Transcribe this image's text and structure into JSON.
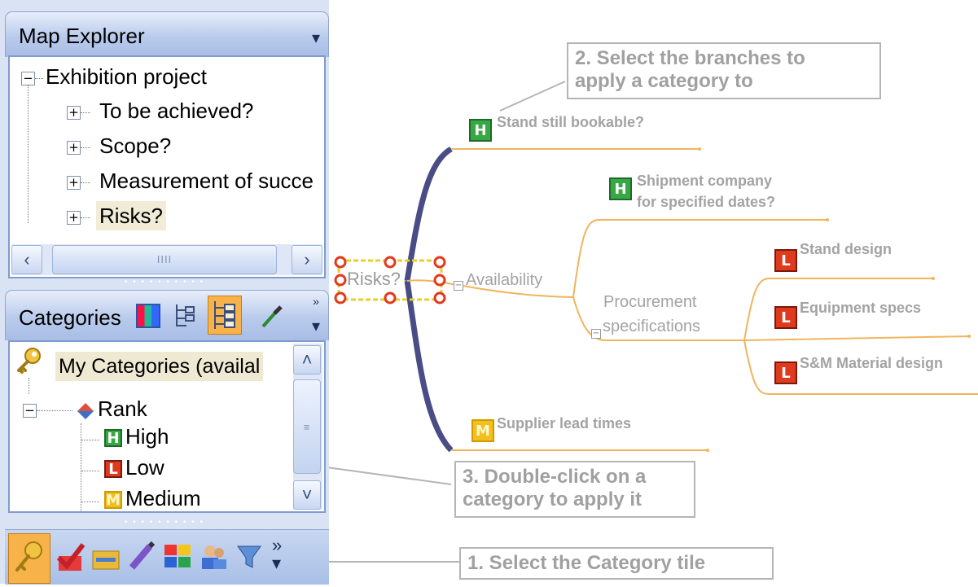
{
  "map_explorer": {
    "title": "Map Explorer",
    "root": "Exhibition project",
    "items": [
      "To be achieved?",
      "Scope?",
      "Measurement of succe",
      "Risks?"
    ],
    "scroll_grip": "IIII"
  },
  "categories_pane": {
    "title": "Categories",
    "group": "My Categories (availal",
    "rank": "Rank",
    "items": [
      {
        "tag": "H",
        "label": "High"
      },
      {
        "tag": "L",
        "label": "Low"
      },
      {
        "tag": "M",
        "label": "Medium"
      }
    ]
  },
  "map": {
    "central": "Risks?",
    "topics": {
      "stand": "Stand still bookable?",
      "availability": "Availability",
      "shipment_line1": "Shipment company",
      "shipment_line2": "for specified dates?",
      "procurement_line1": "Procurement",
      "procurement_line2": "specifications",
      "stand_design": "Stand design",
      "equipment": "Equipment specs",
      "sm_material": "S&M Material design",
      "supplier": "Supplier lead times"
    },
    "tags": {
      "stand": "H",
      "shipment": "H",
      "stand_design": "L",
      "equipment": "L",
      "sm_material": "L",
      "supplier": "M"
    }
  },
  "callouts": {
    "step2_line1": "2. Select the branches to",
    "step2_line2": "apply a category to",
    "step3_line1": "3. Double-click on a",
    "step3_line2": "category to apply it",
    "step1": "1. Select the Category tile"
  },
  "colors": {
    "main_branch": "#4a4c86",
    "sub_branch": "#f0b55c",
    "callout_text": "#a0a0a0",
    "panel_bg": "#d9e3f4"
  },
  "icons": {
    "toolbar": [
      "category-grid-icon",
      "tree-view-icon",
      "list-view-icon",
      "eyedropper-icon",
      "overflow-icon"
    ],
    "bottom_bar": [
      "key-icon",
      "check-icon",
      "folder-icon",
      "pen-icon",
      "palette-icon",
      "contacts-icon",
      "filter-icon",
      "more-icon"
    ]
  }
}
